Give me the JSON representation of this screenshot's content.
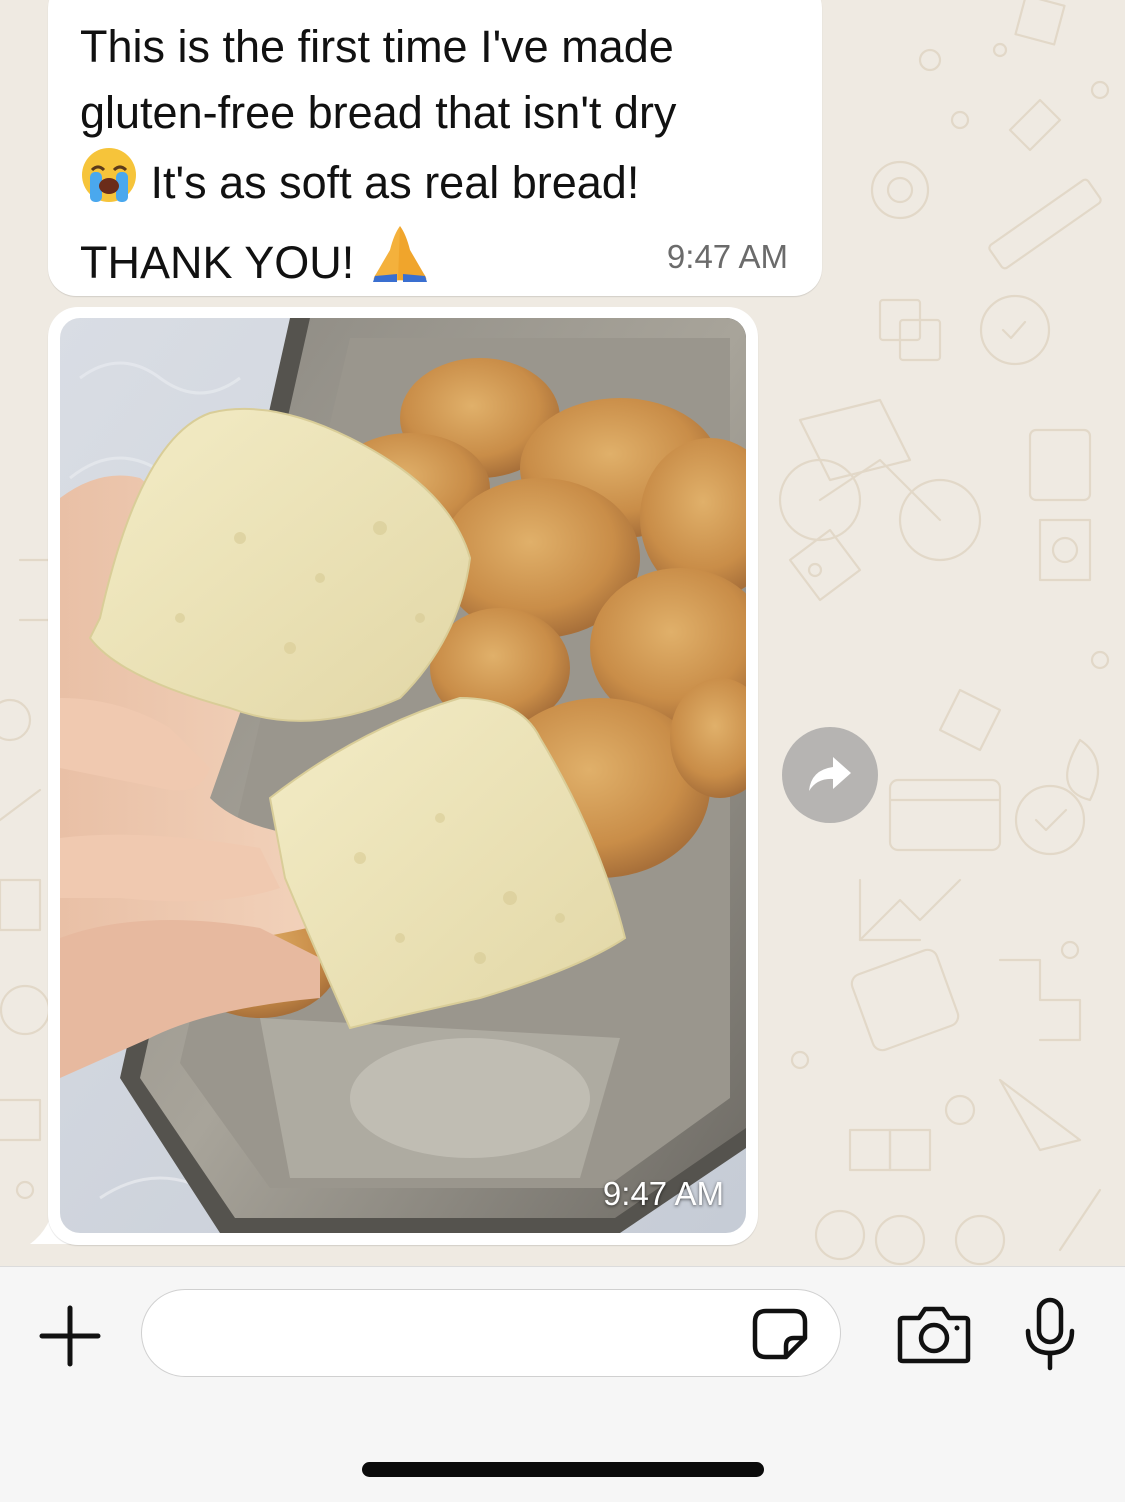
{
  "conversation": {
    "text_message": {
      "lines": [
        "This is the first time I've made",
        "gluten-free bread that isn't dry",
        " It's as soft as real bread!",
        "THANK YOU! "
      ],
      "time": "9:47 AM"
    },
    "image_message": {
      "time": "9:47 AM"
    }
  },
  "composer": {
    "input_value": "",
    "input_placeholder": ""
  },
  "colors": {
    "wallpaper": "#efeae2",
    "bubble": "#ffffff",
    "forward_button": "#a0a0a0",
    "icon": "#111111"
  },
  "icons": {
    "forward": "share-forward-icon",
    "plus": "plus-icon",
    "sticker": "sticker-icon",
    "camera": "camera-icon",
    "microphone": "microphone-icon",
    "emoji_cry": "loudly-crying-face-emoji",
    "emoji_pray": "folded-hands-emoji"
  }
}
